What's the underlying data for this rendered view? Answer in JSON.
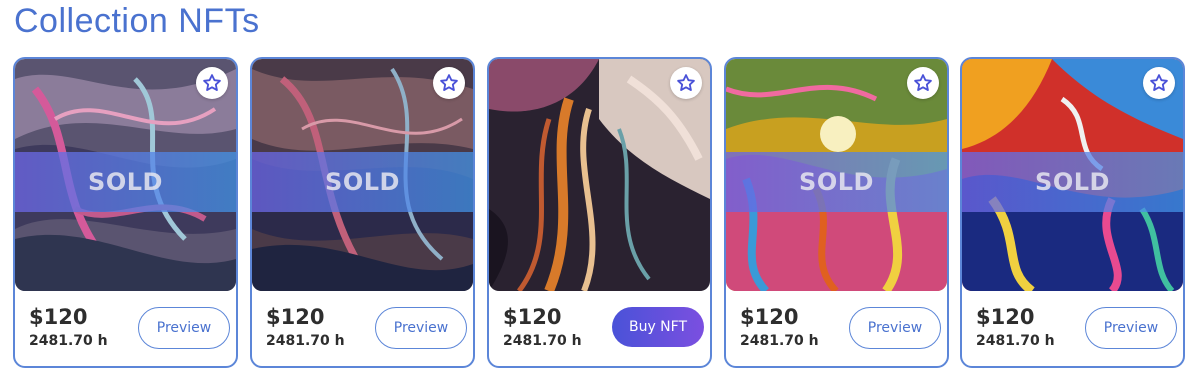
{
  "page": {
    "title": "Collection NFTs"
  },
  "colors": {
    "accent": "#4a72cf",
    "border": "#5c86d8",
    "buy_gradient_start": "#4a52d8",
    "buy_gradient_end": "#7b4fe0"
  },
  "cards": [
    {
      "price": "$120",
      "hours": "2481.70 h",
      "sold_label": "SOLD",
      "action_label": "Preview",
      "sold": true,
      "favorite_icon": "star-icon"
    },
    {
      "price": "$120",
      "hours": "2481.70 h",
      "sold_label": "SOLD",
      "action_label": "Preview",
      "sold": true,
      "favorite_icon": "star-icon"
    },
    {
      "price": "$120",
      "hours": "2481.70 h",
      "sold_label": "",
      "action_label": "Buy NFT",
      "sold": false,
      "favorite_icon": "star-icon"
    },
    {
      "price": "$120",
      "hours": "2481.70 h",
      "sold_label": "SOLD",
      "action_label": "Preview",
      "sold": true,
      "favorite_icon": "star-icon"
    },
    {
      "price": "$120",
      "hours": "2481.70 h",
      "sold_label": "SOLD",
      "action_label": "Preview",
      "sold": true,
      "favorite_icon": "star-icon"
    }
  ]
}
